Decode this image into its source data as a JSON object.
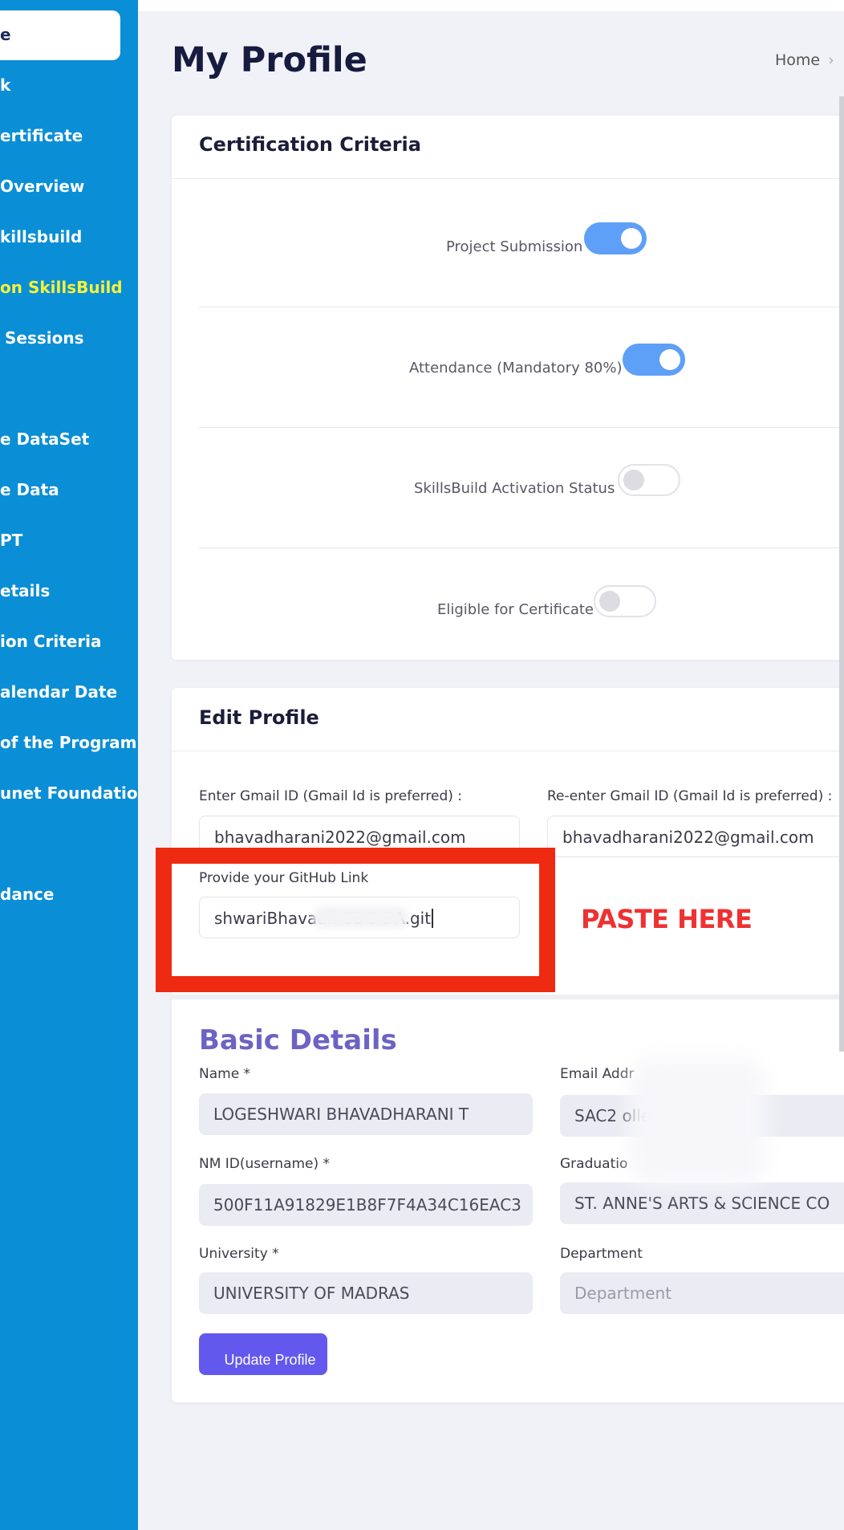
{
  "sidebar": {
    "active_item": "e",
    "items": [
      {
        "label": "k",
        "highlight": false
      },
      {
        "label": "ertificate",
        "highlight": false
      },
      {
        "label": "Overview",
        "highlight": false
      },
      {
        "label": "killsbuild",
        "highlight": false
      },
      {
        "label": "on SkillsBuild",
        "highlight": true
      },
      {
        "label": "Sessions",
        "highlight": false
      },
      {
        "label": "e DataSet",
        "highlight": false
      },
      {
        "label": "e Data",
        "highlight": false
      },
      {
        "label": "PT",
        "highlight": false
      },
      {
        "label": "etails",
        "highlight": false
      },
      {
        "label": "ion Criteria",
        "highlight": false
      },
      {
        "label": "alendar Date",
        "highlight": false
      },
      {
        "label": "of the Program",
        "highlight": false
      },
      {
        "label": "unet Foundation",
        "highlight": false
      },
      {
        "label": "dance",
        "highlight": false
      }
    ]
  },
  "header": {
    "title": "My Profile",
    "breadcrumb_home": "Home",
    "breadcrumb_sep": "›"
  },
  "criteria": {
    "title": "Certification Criteria",
    "rows": [
      {
        "label": "Project Submission",
        "on": true
      },
      {
        "label": "Attendance (Mandatory 80%)",
        "on": true
      },
      {
        "label": "SkillsBuild Activation Status",
        "on": false
      },
      {
        "label": "Eligible for Certificate",
        "on": false
      }
    ]
  },
  "edit_profile": {
    "title": "Edit Profile",
    "gmail_label": "Enter Gmail ID (Gmail Id is preferred) :",
    "gmail_value": "bhavadharani2022@gmail.com",
    "regmail_label": "Re-enter Gmail ID (Gmail Id is preferred) :",
    "regmail_value": "bhavadharani2022@gmail.com",
    "github_label": "Provide your GitHub Link",
    "github_value": "shwariBhavadh          SDC-DA.git",
    "annotation": "PASTE HERE"
  },
  "basic_details": {
    "title": "Basic Details",
    "name_label": "Name *",
    "name_value": "LOGESHWARI BHAVADHARANI T",
    "email_label": "Email Addr",
    "email_value": "SAC2                    ollegechenn",
    "nmid_label": "NM ID(username) *",
    "nmid_value": "500F11A91829E1B8F7F4A34C16EAC3",
    "graduation_label": "Graduatio",
    "graduation_value": "ST. ANNE'S ARTS & SCIENCE CO",
    "university_label": "University *",
    "university_value": "UNIVERSITY OF MADRAS",
    "department_label": "Department",
    "department_placeholder": "Department",
    "update_button": "Update Profile"
  },
  "colors": {
    "sidebar": "#0a8ed6",
    "highlight": "#f4f23a",
    "toggle_on": "#5e9ff7",
    "annotation_red": "#ee2b12",
    "button": "#6358ee"
  }
}
